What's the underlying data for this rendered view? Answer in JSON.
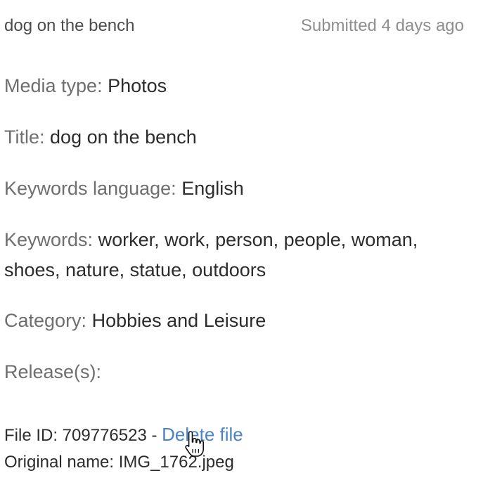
{
  "header": {
    "asset_name": "dog on the bench",
    "submitted": "Submitted 4 days ago"
  },
  "fields": {
    "media_type": {
      "label": "Media type:",
      "value": "Photos"
    },
    "title": {
      "label": "Title:",
      "value": "dog on the bench"
    },
    "keywords_language": {
      "label": "Keywords language:",
      "value": "English"
    },
    "keywords": {
      "label": "Keywords:",
      "value": "worker, work, person, people, woman, shoes, nature, statue, outdoors"
    },
    "category": {
      "label": "Category:",
      "value": "Hobbies and Leisure"
    },
    "releases": {
      "label": "Release(s):",
      "value": ""
    }
  },
  "file": {
    "id_label": "File ID: 709776523 - ",
    "delete_label": "Delete file",
    "original_label": "Original name: IMG_1762.jpeg"
  },
  "cursor": {
    "icon": "hand-pointer-icon"
  }
}
